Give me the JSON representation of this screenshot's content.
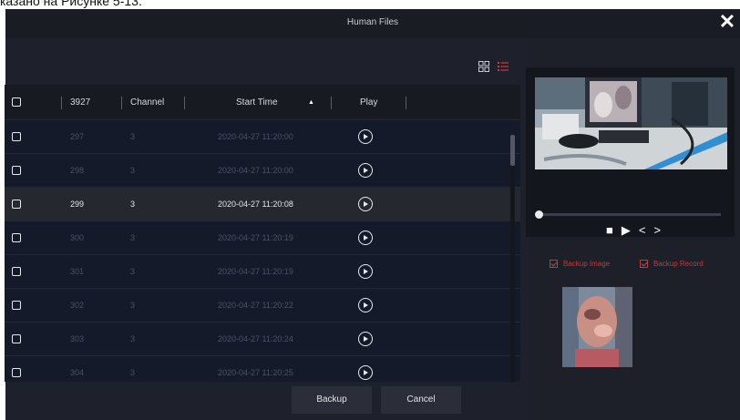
{
  "caption": "казано на Рисунке 5-13.",
  "window": {
    "title": "Human Files",
    "close_glyph": "✕"
  },
  "view": {
    "grid_icon": "grid-view-icon",
    "list_icon": "list-view-icon",
    "active": "list"
  },
  "table": {
    "headers": {
      "count": "3927",
      "channel": "Channel",
      "start_time": "Start Time",
      "play": "Play"
    },
    "sort_indicator": "▲",
    "rows": [
      {
        "id": "297",
        "channel": "3",
        "time": "2020-04-27 11:20:00",
        "selected": false
      },
      {
        "id": "298",
        "channel": "3",
        "time": "2020-04-27 11:20:00",
        "selected": false
      },
      {
        "id": "299",
        "channel": "3",
        "time": "2020-04-27 11:20:08",
        "selected": true
      },
      {
        "id": "300",
        "channel": "3",
        "time": "2020-04-27 11:20:19",
        "selected": false
      },
      {
        "id": "301",
        "channel": "3",
        "time": "2020-04-27 11:20:19",
        "selected": false
      },
      {
        "id": "302",
        "channel": "3",
        "time": "2020-04-27 11:20:22",
        "selected": false
      },
      {
        "id": "303",
        "channel": "3",
        "time": "2020-04-27 11:20:24",
        "selected": false
      },
      {
        "id": "304",
        "channel": "3",
        "time": "2020-04-27 11:20:25",
        "selected": false
      }
    ]
  },
  "buttons": {
    "backup": "Backup",
    "cancel": "Cancel"
  },
  "player": {
    "progress": 0.0,
    "controls": [
      "stop-icon",
      "play-icon",
      "prev-icon",
      "next-icon"
    ]
  },
  "options": {
    "backup_image": "Backup Image",
    "backup_record": "Backup Record",
    "backup_image_checked": true,
    "backup_record_checked": true
  },
  "colors": {
    "accent": "#c43a3a",
    "background": "#1d2029",
    "row_bg": "#151a2b",
    "selected_row": "#262830"
  }
}
